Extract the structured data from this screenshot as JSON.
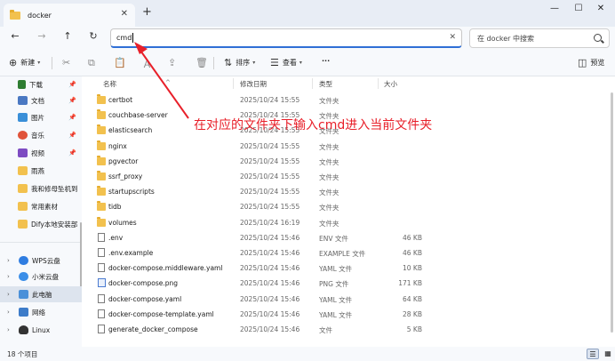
{
  "tab": {
    "title": "docker"
  },
  "address": {
    "value": "cmd"
  },
  "search": {
    "placeholder": "在 docker 中搜索"
  },
  "toolbar": {
    "new_label": "新建",
    "sort_label": "排序",
    "view_label": "查看",
    "more_label": "···",
    "preview_label": "预览"
  },
  "sidebar": {
    "items": [
      {
        "label": "下载",
        "icon": "download-icon",
        "pinned": true
      },
      {
        "label": "文档",
        "icon": "document-icon",
        "pinned": true
      },
      {
        "label": "图片",
        "icon": "picture-icon",
        "pinned": true
      },
      {
        "label": "音乐",
        "icon": "music-icon",
        "pinned": true
      },
      {
        "label": "视频",
        "icon": "video-icon",
        "pinned": true
      },
      {
        "label": "雨燕",
        "icon": "folder-icon",
        "pinned": false
      },
      {
        "label": "我和修母坠机到",
        "icon": "folder-icon",
        "pinned": false
      },
      {
        "label": "常用素材",
        "icon": "folder-icon",
        "pinned": false
      },
      {
        "label": "Dify本地安装部",
        "icon": "folder-icon",
        "pinned": false
      }
    ],
    "drives": [
      {
        "label": "WPS云盘",
        "icon": "cloud-icon"
      },
      {
        "label": "小米云盘",
        "icon": "cloud-icon"
      },
      {
        "label": "此电脑",
        "icon": "computer-icon"
      },
      {
        "label": "网络",
        "icon": "network-icon"
      },
      {
        "label": "Linux",
        "icon": "linux-icon"
      }
    ]
  },
  "columns": {
    "name": "名称",
    "date": "修改日期",
    "type": "类型",
    "size": "大小"
  },
  "files": [
    {
      "name": "certbot",
      "date": "2025/10/24 15:55",
      "type": "文件夹",
      "size": "",
      "kind": "folder"
    },
    {
      "name": "couchbase-server",
      "date": "2025/10/24 15:55",
      "type": "文件夹",
      "size": "",
      "kind": "folder"
    },
    {
      "name": "elasticsearch",
      "date": "2025/10/24 15:55",
      "type": "文件夹",
      "size": "",
      "kind": "folder"
    },
    {
      "name": "nginx",
      "date": "2025/10/24 15:55",
      "type": "文件夹",
      "size": "",
      "kind": "folder"
    },
    {
      "name": "pgvector",
      "date": "2025/10/24 15:55",
      "type": "文件夹",
      "size": "",
      "kind": "folder"
    },
    {
      "name": "ssrf_proxy",
      "date": "2025/10/24 15:55",
      "type": "文件夹",
      "size": "",
      "kind": "folder"
    },
    {
      "name": "startupscripts",
      "date": "2025/10/24 15:55",
      "type": "文件夹",
      "size": "",
      "kind": "folder"
    },
    {
      "name": "tidb",
      "date": "2025/10/24 15:55",
      "type": "文件夹",
      "size": "",
      "kind": "folder"
    },
    {
      "name": "volumes",
      "date": "2025/10/24 16:19",
      "type": "文件夹",
      "size": "",
      "kind": "folder"
    },
    {
      "name": ".env",
      "date": "2025/10/24 15:46",
      "type": "ENV 文件",
      "size": "46 KB",
      "kind": "file"
    },
    {
      "name": ".env.example",
      "date": "2025/10/24 15:46",
      "type": "EXAMPLE 文件",
      "size": "46 KB",
      "kind": "file"
    },
    {
      "name": "docker-compose.middleware.yaml",
      "date": "2025/10/24 15:46",
      "type": "YAML 文件",
      "size": "10 KB",
      "kind": "file"
    },
    {
      "name": "docker-compose.png",
      "date": "2025/10/24 15:46",
      "type": "PNG 文件",
      "size": "171 KB",
      "kind": "image"
    },
    {
      "name": "docker-compose.yaml",
      "date": "2025/10/24 15:46",
      "type": "YAML 文件",
      "size": "64 KB",
      "kind": "file"
    },
    {
      "name": "docker-compose-template.yaml",
      "date": "2025/10/24 15:46",
      "type": "YAML 文件",
      "size": "28 KB",
      "kind": "file"
    },
    {
      "name": "generate_docker_compose",
      "date": "2025/10/24 15:46",
      "type": "文件",
      "size": "5 KB",
      "kind": "file"
    }
  ],
  "status": {
    "count": "18 个项目"
  },
  "annotation": {
    "text": "在对应的文件夹下输入cmd进入当前文件夹",
    "color": "#e8202a"
  }
}
